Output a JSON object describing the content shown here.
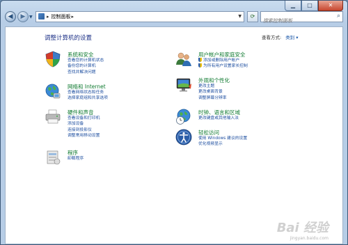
{
  "window": {
    "controls": {
      "minimize": "▁",
      "maximize": "□",
      "close": "✕"
    }
  },
  "nav": {
    "back_icon": "◀",
    "forward_icon": "▶",
    "address": {
      "label": "控制面板",
      "separator": "▸"
    },
    "search_placeholder": "搜索控制面板"
  },
  "content": {
    "heading": "调整计算机的设置",
    "view_by_label": "查看方式:",
    "view_by_value": "类别 ▾"
  },
  "categories": [
    {
      "title": "系统和安全",
      "icon": "security-shield-icon",
      "links": [
        "查看您的计算机状态",
        "备份您的计算机",
        "查找并解决问题"
      ]
    },
    {
      "title": "网络和 Internet",
      "icon": "network-globe-icon",
      "links": [
        "查看网络状态和任务",
        "选择家庭组和共享选项"
      ]
    },
    {
      "title": "硬件和声音",
      "icon": "printer-hardware-icon",
      "links": [
        "查看设备和打印机",
        "添加设备",
        "连接到投影仪",
        "调整常用移动设置"
      ]
    },
    {
      "title": "程序",
      "icon": "programs-icon",
      "links": [
        "卸载程序"
      ]
    },
    {
      "title": "用户帐户和家庭安全",
      "icon": "users-icon",
      "links": [
        "添加或删除用户帐户",
        "为所有用户设置家长控制"
      ]
    },
    {
      "title": "外观和个性化",
      "icon": "display-icon",
      "links": [
        "更改主题",
        "更改桌面背景",
        "调整屏幕分辨率"
      ]
    },
    {
      "title": "时钟、语言和区域",
      "icon": "clock-globe-icon",
      "links": [
        "更改键盘或其他输入法"
      ]
    },
    {
      "title": "轻松访问",
      "icon": "accessibility-icon",
      "links": [
        "使用 Windows 建议的设置",
        "优化视频显示"
      ]
    }
  ],
  "watermark": {
    "text": "Bai 经验",
    "sub": "jingyan.baidu.com"
  }
}
